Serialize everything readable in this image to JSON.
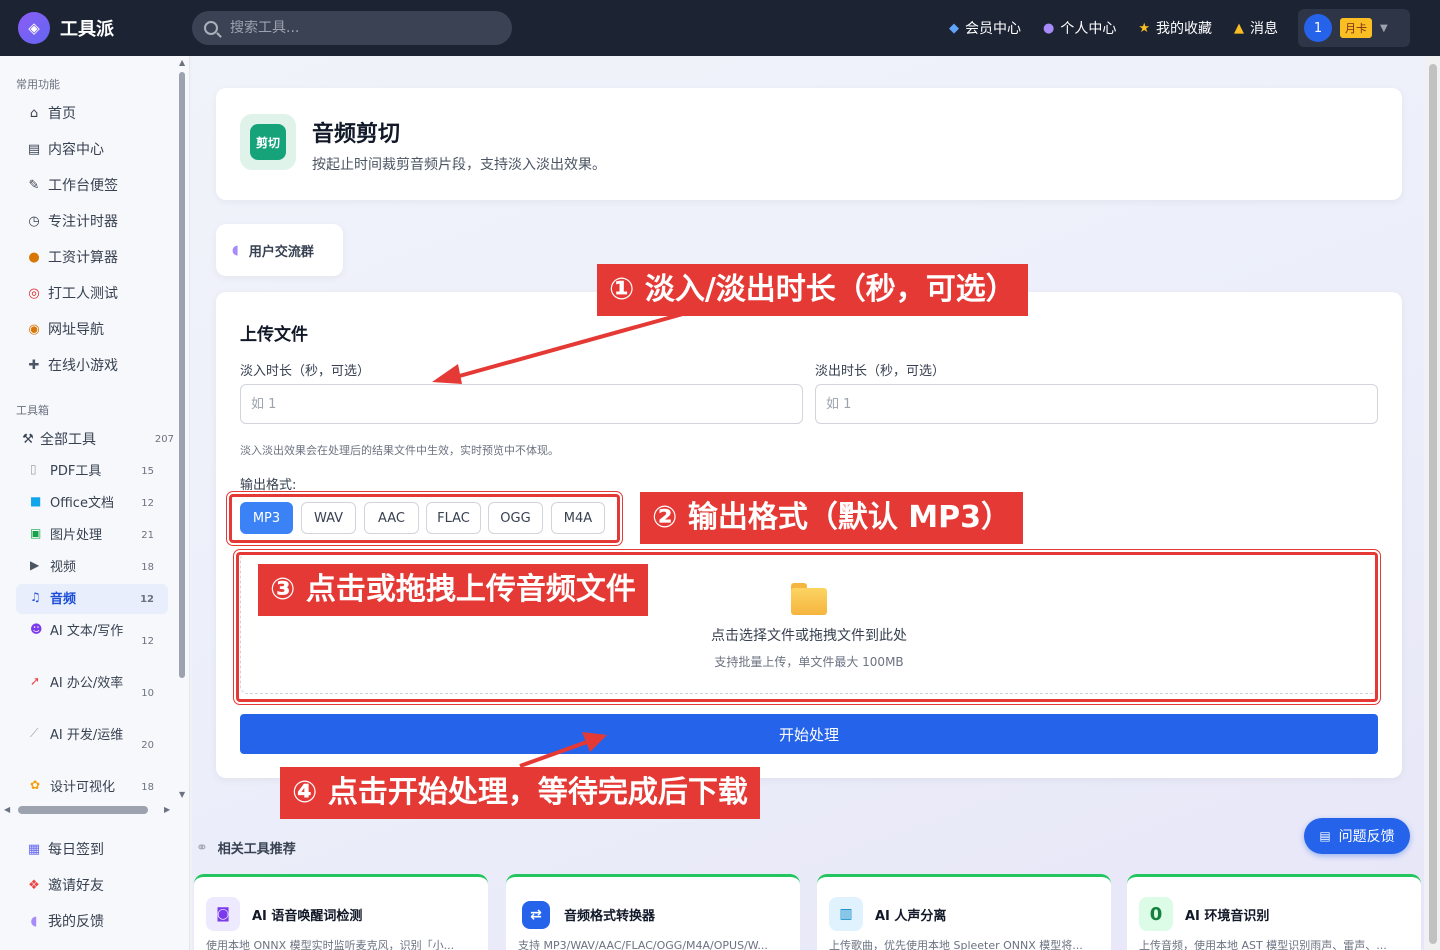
{
  "app": {
    "name": "工具派"
  },
  "search": {
    "placeholder": "搜索工具..."
  },
  "nav": {
    "member": "会员中心",
    "profile": "个人中心",
    "favorites": "我的收藏",
    "messages": "消息"
  },
  "user": {
    "avatar_text": "1",
    "badge": "月卡"
  },
  "sidebar": {
    "common_title": "常用功能",
    "common": [
      {
        "icon": "home-icon",
        "label": "首页"
      },
      {
        "icon": "content-icon",
        "label": "内容中心"
      },
      {
        "icon": "notes-icon",
        "label": "工作台便签"
      },
      {
        "icon": "timer-icon",
        "label": "专注计时器"
      },
      {
        "icon": "money-bag-icon",
        "label": "工资计算器"
      },
      {
        "icon": "target-icon",
        "label": "打工人测试"
      },
      {
        "icon": "compass-icon",
        "label": "网址导航"
      },
      {
        "icon": "gamepad-icon",
        "label": "在线小游戏"
      }
    ],
    "toolbox_title": "工具箱",
    "all_tools": {
      "label": "全部工具",
      "count": "207"
    },
    "categories": [
      {
        "icon": "pdf-icon",
        "label": "PDF工具",
        "count": "15"
      },
      {
        "icon": "office-icon",
        "label": "Office文档",
        "count": "12"
      },
      {
        "icon": "image-icon",
        "label": "图片处理",
        "count": "21"
      },
      {
        "icon": "video-icon",
        "label": "视频",
        "count": "18"
      },
      {
        "icon": "music-icon",
        "label": "音频",
        "count": "12"
      },
      {
        "icon": "robot-icon",
        "label": "AI 文本/写作",
        "count": "12"
      },
      {
        "icon": "rocket-icon",
        "label": "AI 办公/效率",
        "count": "10"
      },
      {
        "icon": "bone-icon",
        "label": "AI 开发/运维",
        "count": "20"
      },
      {
        "icon": "palette-icon",
        "label": "设计可视化",
        "count": "18"
      }
    ],
    "bottom": [
      {
        "icon": "calendar-icon",
        "label": "每日签到"
      },
      {
        "icon": "gift-icon",
        "label": "邀请好友"
      },
      {
        "icon": "chat-icon",
        "label": "我的反馈"
      }
    ]
  },
  "tool": {
    "icon_text": "剪切",
    "title": "音频剪切",
    "description": "按起止时间裁剪音频片段，支持淡入淡出效果。"
  },
  "community": {
    "label": "用户交流群"
  },
  "upload": {
    "section_title": "上传文件",
    "fade_in_label": "淡入时长（秒，可选）",
    "fade_in_placeholder": "如 1",
    "fade_out_label": "淡出时长（秒，可选）",
    "fade_out_placeholder": "如 1",
    "hint": "淡入淡出效果会在处理后的结果文件中生效，实时预览中不体现。",
    "format_label": "输出格式:",
    "formats": [
      "MP3",
      "WAV",
      "AAC",
      "FLAC",
      "OGG",
      "M4A"
    ],
    "selected_format": "MP3",
    "dropzone_main": "点击选择文件或拖拽文件到此处",
    "dropzone_sub": "支持批量上传，单文件最大 100MB",
    "start_button": "开始处理"
  },
  "annotations": [
    "① 淡入/淡出时长（秒，可选）",
    "② 输出格式（默认 MP3）",
    "③ 点击或拖拽上传音频文件",
    "④ 点击开始处理，等待完成后下载"
  ],
  "related": {
    "title": "相关工具推荐",
    "items": [
      {
        "icon": "wake-word-icon",
        "title": "AI 语音唤醒词检测",
        "desc": "使用本地 ONNX 模型实时监听麦克风，识别「小..."
      },
      {
        "icon": "convert-icon",
        "title": "音频格式转换器",
        "desc": "支持 MP3/WAV/AAC/FLAC/OGG/M4A/OPUS/W..."
      },
      {
        "icon": "separate-icon",
        "title": "AI 人声分离",
        "desc": "上传歌曲，优先使用本地 Spleeter ONNX 模型将..."
      },
      {
        "icon": "env-sound-icon",
        "icon_text": "0",
        "title": "AI 环境音识别",
        "desc": "上传音频，使用本地 AST 模型识别雨声、雷声、..."
      }
    ]
  },
  "feedback": {
    "label": "问题反馈"
  },
  "colors": {
    "accent": "#2563eb",
    "annotation": "#e53935",
    "topbar": "#1c2333",
    "tool_icon": "#16a37a"
  }
}
